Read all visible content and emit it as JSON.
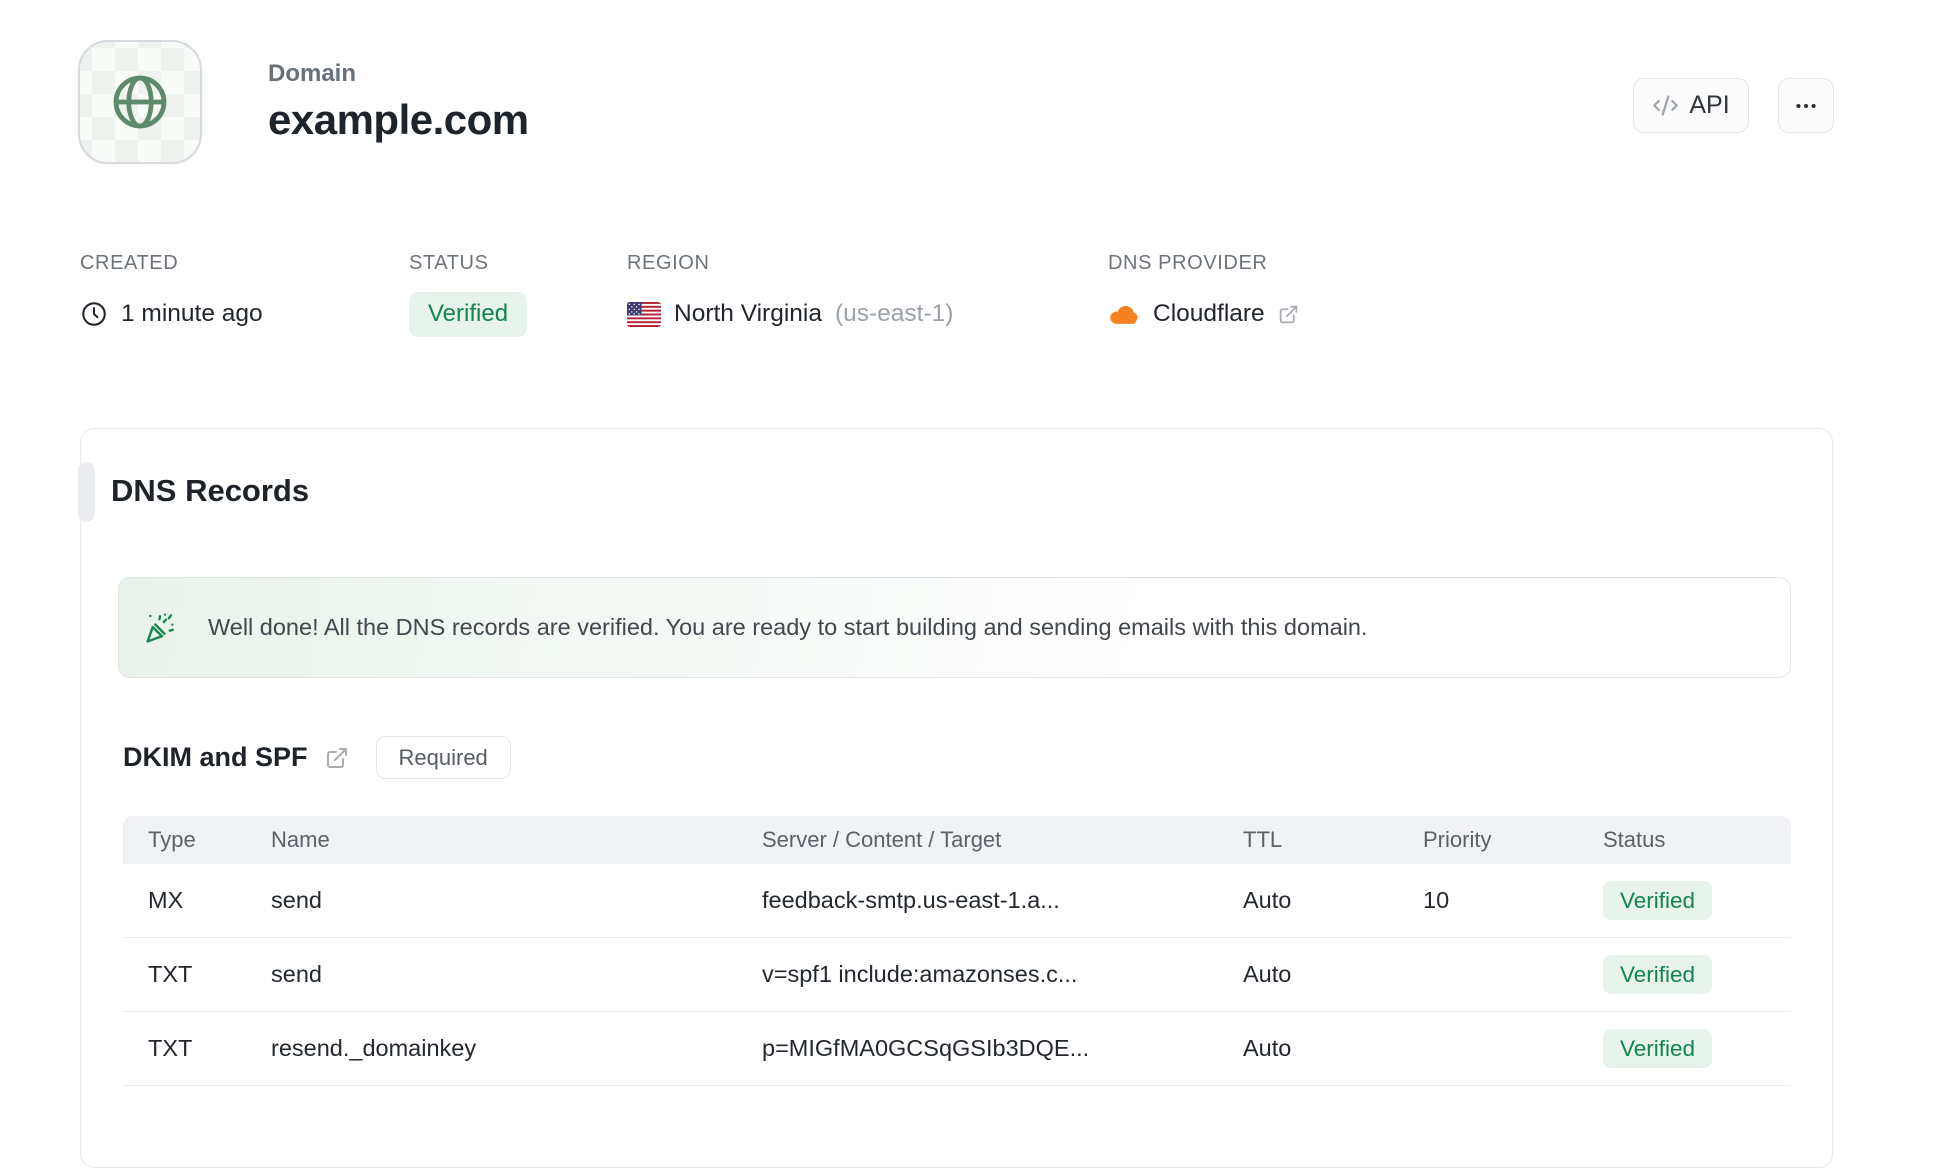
{
  "header": {
    "eyebrow": "Domain",
    "title": "example.com",
    "api_button": "API"
  },
  "meta": {
    "created": {
      "label": "CREATED",
      "value": "1 minute ago"
    },
    "status": {
      "label": "STATUS",
      "value": "Verified"
    },
    "region": {
      "label": "REGION",
      "name": "North Virginia",
      "code": "(us-east-1)"
    },
    "dns_provider": {
      "label": "DNS PROVIDER",
      "value": "Cloudflare"
    }
  },
  "dns_card": {
    "title": "DNS Records",
    "banner": "Well done! All the DNS records are verified. You are ready to start building and sending emails with this domain.",
    "section": {
      "title": "DKIM and SPF",
      "badge": "Required"
    },
    "table": {
      "headers": [
        "Type",
        "Name",
        "Server / Content / Target",
        "TTL",
        "Priority",
        "Status"
      ],
      "rows": [
        {
          "type": "MX",
          "name": "send",
          "content": "feedback-smtp.us-east-1.a...",
          "ttl": "Auto",
          "priority": "10",
          "status": "Verified"
        },
        {
          "type": "TXT",
          "name": "send",
          "content": "v=spf1 include:amazonses.c...",
          "ttl": "Auto",
          "priority": "",
          "status": "Verified"
        },
        {
          "type": "TXT",
          "name": "resend._domainkey",
          "content": "p=MIGfMA0GCSqGSIb3DQE...",
          "ttl": "Auto",
          "priority": "",
          "status": "Verified"
        }
      ]
    }
  },
  "icons": {
    "globe-icon": "green wireframe globe",
    "code-icon": "</>",
    "ellipsis-icon": "...",
    "clock-icon": "clock face",
    "us-flag-icon": "United States flag",
    "cloudflare-icon": "orange cloud",
    "external-link-icon": "box with arrow",
    "party-popper-icon": "green confetti cone"
  },
  "colors": {
    "accent-green": "#12854e",
    "badge-green-bg": "#e8f3ec",
    "banner-green": "#e8f2ea",
    "globe-green": "#5d8a6c",
    "cloudflare-orange": "#f6821f",
    "table-header-bg": "#f1f2f5"
  }
}
